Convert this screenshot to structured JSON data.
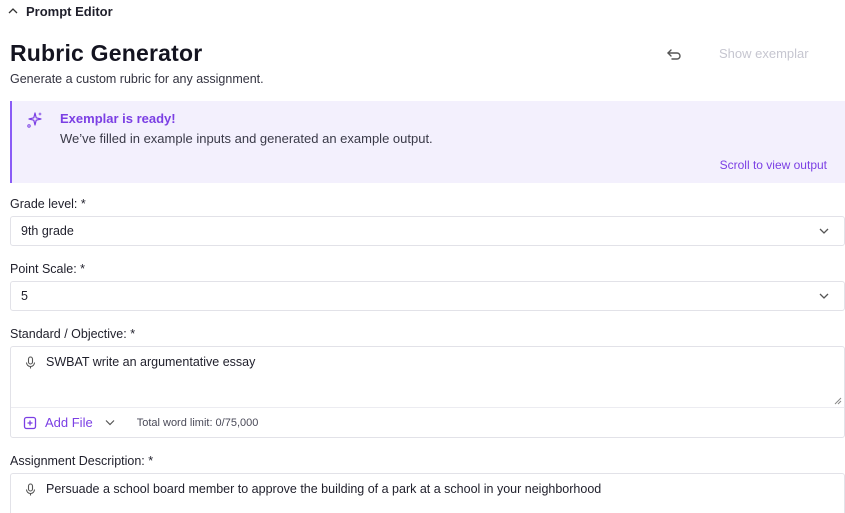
{
  "header": {
    "section_toggle_label": "Prompt Editor",
    "title": "Rubric Generator",
    "subtitle": "Generate a custom rubric for any assignment.",
    "show_exemplar_label": "Show exemplar"
  },
  "banner": {
    "title": "Exemplar is ready!",
    "text": "We’ve filled in example inputs and generated an example output.",
    "link": "Scroll to view output"
  },
  "fields": {
    "grade_level": {
      "label": "Grade level: *",
      "value": "9th grade"
    },
    "point_scale": {
      "label": "Point Scale: *",
      "value": "5"
    },
    "standard": {
      "label": "Standard / Objective: *",
      "value": "SWBAT write an argumentative essay",
      "add_file_label": "Add File",
      "word_limit": "Total word limit: 0/75,000"
    },
    "assignment_description": {
      "label": "Assignment Description: *",
      "value": "Persuade a school board member to approve the building of a park at a school in your neighborhood"
    }
  },
  "colors": {
    "accent": "#7b3fe4",
    "banner_bg": "#f3f0fd",
    "banner_border": "#8a5cf6",
    "muted": "#c6c6d0"
  },
  "icons": {
    "collapse": "chevron-up-icon",
    "undo": "undo-icon",
    "banner": "sparkles-icon",
    "dropdown": "chevron-down-icon",
    "voice": "microphone-icon",
    "file": "add-file-icon",
    "resize": "resize-handle-icon"
  }
}
